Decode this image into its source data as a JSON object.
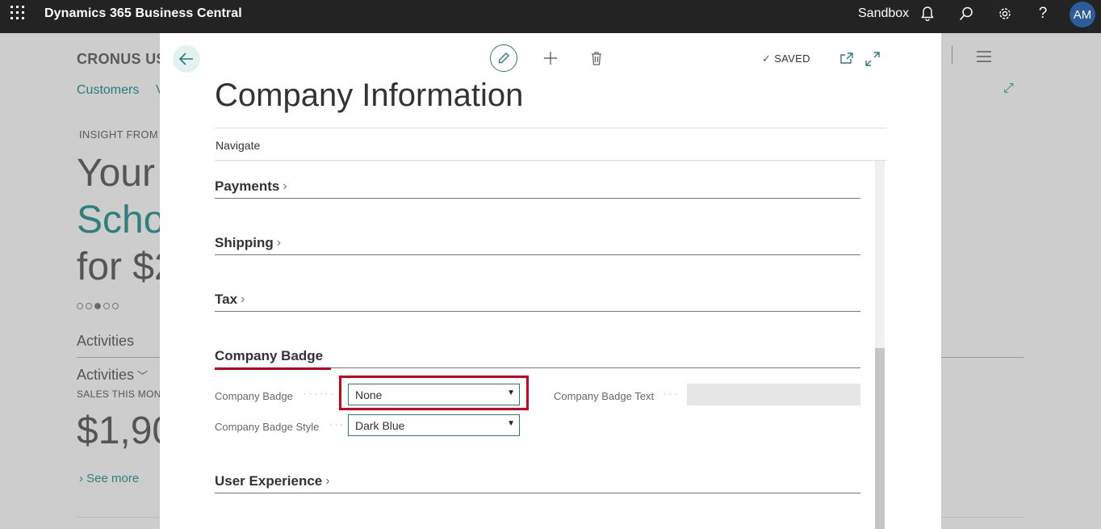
{
  "topbar": {
    "app_title": "Dynamics 365 Business Central",
    "environment": "Sandbox",
    "avatar_initials": "AM",
    "icons": [
      "waffle-icon",
      "bell-icon",
      "search-icon",
      "gear-icon",
      "help-icon"
    ]
  },
  "background": {
    "company": "CRONUS US",
    "nav_items": [
      "Customers",
      "V"
    ],
    "insight_label": "INSIGHT FROM L",
    "headline_lines": [
      "Your",
      "Scho",
      "for $2"
    ],
    "activities_title": "Activities",
    "activities_group": "Activities",
    "sales_label": "SALES THIS MON",
    "sales_amount": "$1,90",
    "see_more": "See more"
  },
  "dialog": {
    "title": "Company Information",
    "status": "SAVED",
    "actions": {
      "navigate": "Navigate"
    },
    "sections": {
      "payments": "Payments",
      "shipping": "Shipping",
      "tax": "Tax",
      "company_badge": "Company Badge",
      "user_experience": "User Experience"
    },
    "fields": {
      "company_badge_label": "Company Badge",
      "company_badge_value": "None",
      "company_badge_style_label": "Company Badge Style",
      "company_badge_style_value": "Dark Blue",
      "company_badge_text_label": "Company Badge Text",
      "company_badge_text_value": ""
    }
  },
  "colors": {
    "topbar": "#232323",
    "accent": "#2a7b78",
    "highlight": "#d0021b"
  }
}
